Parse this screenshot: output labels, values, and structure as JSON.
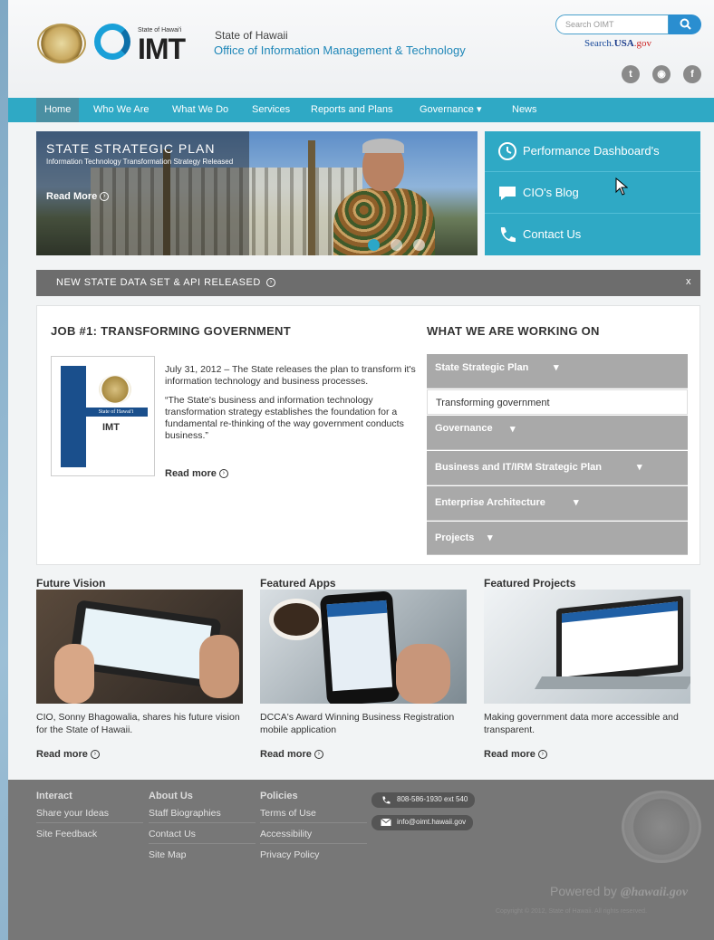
{
  "header": {
    "org_line1": "State of Hawaii",
    "org_line2": "Office of Information Management & Technology",
    "logo_text": "IMT",
    "logo_small": "State of Hawai'i",
    "search_placeholder": "Search OIMT",
    "searchusa": {
      "a": "Search.",
      "b": "USA",
      "c": ".gov"
    },
    "social": [
      "twitter-icon",
      "rss-icon",
      "facebook-icon"
    ]
  },
  "nav": {
    "items": [
      "Home",
      "Who We Are",
      "What We Do",
      "Services",
      "Reports and Plans",
      "Governance",
      "News"
    ],
    "governance_caret": "▾"
  },
  "hero": {
    "title": "STATE STRATEGIC PLAN",
    "subtitle": "Information Technology Transformation Strategy Released",
    "more": "Read More"
  },
  "side_panel": {
    "items": [
      "Performance Dashboard's",
      "CIO's Blog",
      "Contact Us"
    ]
  },
  "banner": {
    "text": "NEW STATE DATA SET & API RELEASED",
    "close": "x"
  },
  "job": {
    "title": "JOB #1: TRANSFORMING GOVERNMENT",
    "para1": "July 31, 2012 – The State releases the plan to transform it's information technology and business processes.",
    "para2": "“The State's business and information technology transformation strategy establishes the foundation for a fundamental re-thinking of the way government conducts business.”",
    "more": "Read more",
    "thumb_band": "State of Hawai'i",
    "thumb_logo": "IMT"
  },
  "working": {
    "title": "WHAT WE ARE WORKING ON",
    "items": [
      "State Strategic Plan",
      "Governance",
      "Business and IT/IRM Strategic Plan",
      "Enterprise Architecture",
      "Projects"
    ],
    "open_item": "Transforming government"
  },
  "featured": [
    {
      "title": "Future Vision",
      "desc": "CIO, Sonny Bhagowalia, shares his future vision for the State of Hawaii.",
      "more": "Read more"
    },
    {
      "title": "Featured Apps",
      "desc": "DCCA's Award Winning Business Registration mobile application",
      "more": "Read more"
    },
    {
      "title": "Featured Projects",
      "desc": "Making government data more accessible and transparent.",
      "more": "Read more"
    }
  ],
  "footer": {
    "interact": {
      "heading": "Interact",
      "links": [
        "Share your Ideas",
        "Site Feedback"
      ]
    },
    "about": {
      "heading": "About Us",
      "links": [
        "Staff Biographies",
        "Contact Us",
        "Site Map"
      ]
    },
    "policies": {
      "heading": "Policies",
      "links": [
        "Terms of Use",
        "Accessibility",
        "Privacy Policy"
      ]
    },
    "phone": "808-586-1930 ext 540",
    "email": "info@oimt.hawaii.gov",
    "powered_prefix": "Powered by",
    "powered_brand": "@hawaii.gov",
    "copyright": "Copyright © 2012, State of Hawaii. All rights reserved."
  },
  "colors": {
    "accent": "#2fa9c5",
    "nav_active": "#4a8fa2",
    "accordion": "#a9a9a9",
    "footer": "#777777"
  }
}
